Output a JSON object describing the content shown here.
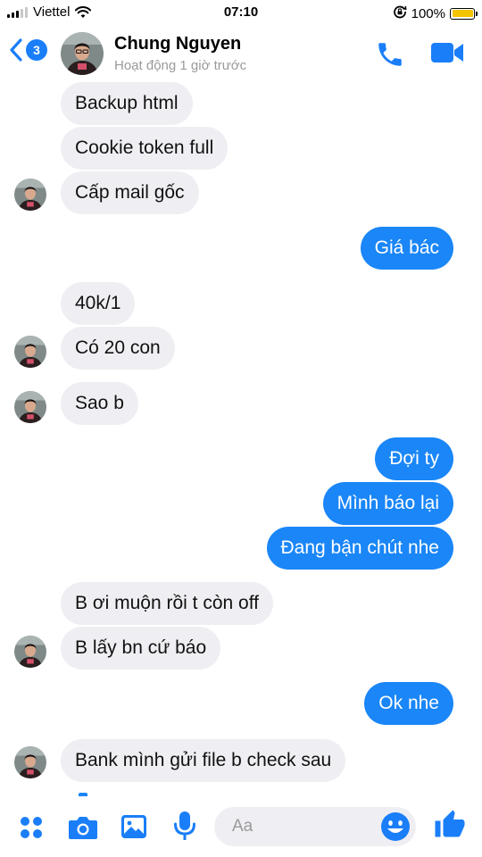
{
  "status_bar": {
    "carrier": "Viettel",
    "time": "07:10",
    "battery": "100%",
    "icons": [
      "signal-icon",
      "wifi-icon",
      "rotation-lock-icon",
      "battery-icon"
    ]
  },
  "header": {
    "back_count": "3",
    "name": "Chung Nguyen",
    "status": "Hoạt động 1 giờ trước",
    "icons": [
      "back-chevron-icon",
      "phone-icon",
      "video-camera-icon"
    ]
  },
  "messages": [
    {
      "from": "them",
      "text": "Backup html"
    },
    {
      "from": "them",
      "text": "Cookie token full"
    },
    {
      "from": "them",
      "text": "Cấp mail gốc"
    },
    {
      "from": "me",
      "text": "Giá bác"
    },
    {
      "from": "them",
      "text": "40k/1"
    },
    {
      "from": "them",
      "text": "Có 20 con"
    },
    {
      "from": "them",
      "text": "Sao b"
    },
    {
      "from": "me",
      "text": "Đợi ty"
    },
    {
      "from": "me",
      "text": "Mình báo lại"
    },
    {
      "from": "me",
      "text": "Đang bận chút nhe"
    },
    {
      "from": "them",
      "text": "B ơi muộn rồi t còn off"
    },
    {
      "from": "them",
      "text": "B lấy bn cứ báo"
    },
    {
      "from": "me",
      "text": "Ok nhe"
    },
    {
      "from": "them",
      "text": "Bank mình gửi file b check sau"
    }
  ],
  "composer": {
    "placeholder": "Aa",
    "icons": [
      "apps-grid-icon",
      "camera-icon",
      "photo-gallery-icon",
      "microphone-icon",
      "emoji-icon",
      "thumbs-up-icon"
    ]
  },
  "colors": {
    "accent": "#1a7ef8",
    "outgoing_bubble": "#1a86f7",
    "incoming_bubble": "#efeff3",
    "battery": "#f5c400"
  }
}
